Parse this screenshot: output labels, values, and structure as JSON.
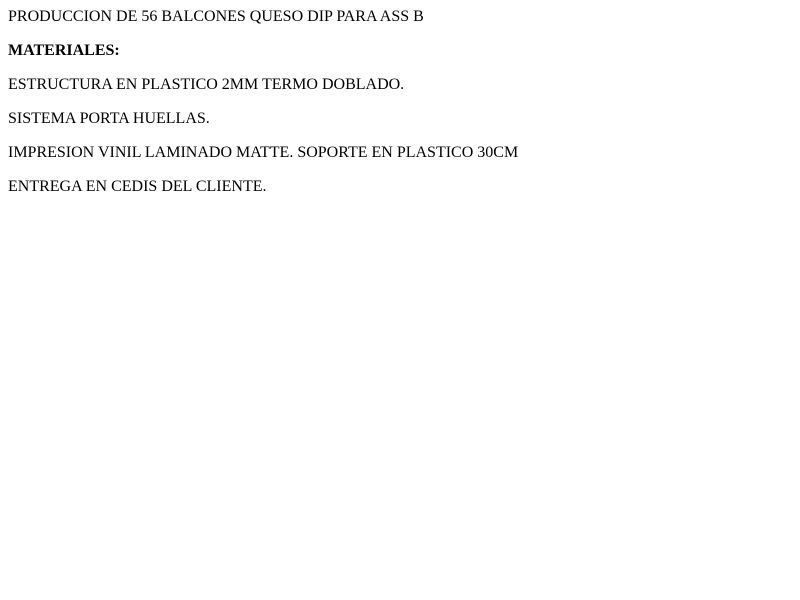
{
  "document": {
    "title": "PRODUCCION DE 56 BALCONES QUESO DIP PARA ASS B",
    "materials_heading": "MATERIALES:",
    "items": [
      "ESTRUCTURA EN PLASTICO 2MM TERMO DOBLADO.",
      "SISTEMA PORTA HUELLAS.",
      "IMPRESION VINIL LAMINADO MATTE. SOPORTE EN PLASTICO 30CM",
      "ENTREGA EN CEDIS DEL CLIENTE."
    ]
  }
}
